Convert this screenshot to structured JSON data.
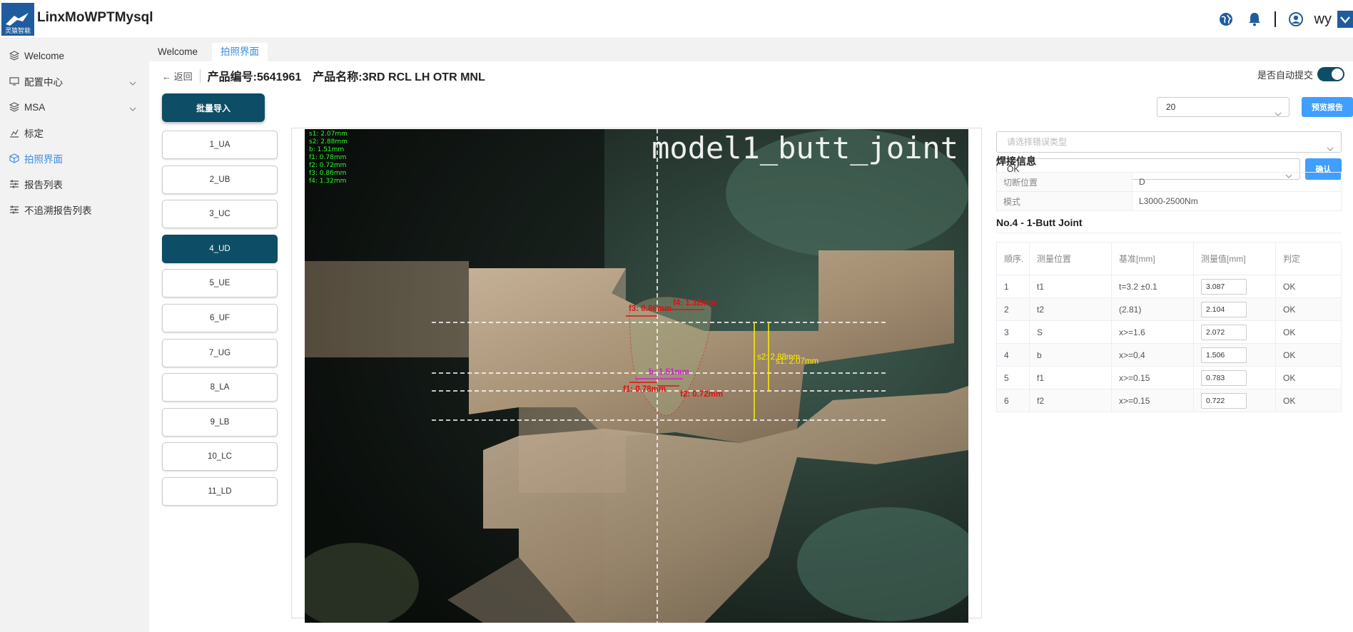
{
  "app": {
    "title": "LinxMoWPTMysql",
    "logo_text": "灵猿智能",
    "username": "wy"
  },
  "sidebar": {
    "items": [
      {
        "label": "Welcome",
        "icon": "layers-icon"
      },
      {
        "label": "配置中心",
        "icon": "monitor-icon",
        "expandable": true
      },
      {
        "label": "MSA",
        "icon": "layers-icon",
        "expandable": true
      },
      {
        "label": "标定",
        "icon": "chart-icon"
      },
      {
        "label": "拍照界面",
        "icon": "cube-icon",
        "active": true
      },
      {
        "label": "报告列表",
        "icon": "sliders-icon"
      },
      {
        "label": "不追溯报告列表",
        "icon": "sliders-icon"
      }
    ]
  },
  "tabs": [
    {
      "label": "Welcome"
    },
    {
      "label": "拍照界面",
      "active": true
    }
  ],
  "header": {
    "back_label": "返回",
    "product_code": "产品编号:5641961",
    "product_name": "产品名称:3RD RCL LH OTR MNL",
    "auto_submit_label": "是否自动提交"
  },
  "left": {
    "import_label": "批量导入",
    "samples": [
      "1_UA",
      "2_UB",
      "3_UC",
      "4_UD",
      "5_UE",
      "6_UF",
      "7_UG",
      "8_LA",
      "9_LB",
      "10_LC",
      "11_LD"
    ],
    "active_sample": "4_UD"
  },
  "image": {
    "title": "model1_butt_joint",
    "measures": [
      "s1: 2.07mm",
      "s2: 2.88mm",
      "b: 1.51mm",
      "f1: 0.78mm",
      "f2: 0.72mm",
      "f3: 0.86mm",
      "f4: 1.32mm"
    ],
    "annotations": {
      "f3": "f3: 0.86mm",
      "f4": "f4: 1.32mm",
      "b": "b: 1.51mm",
      "f1": "f1: 0.78mm",
      "f2": "f2: 0.72mm",
      "s2": "s2: 2.88mm",
      "s1": "s1: 2.07mm"
    }
  },
  "controls": {
    "page_size": "20",
    "preview_label": "预览报告",
    "error_type_placeholder": "请选择错误类型",
    "result_value": "OK",
    "confirm_label": "确认"
  },
  "weld_info": {
    "title": "焊接信息",
    "rows": [
      {
        "key": "切断位置",
        "value": "D"
      },
      {
        "key": "模式",
        "value": "L3000-2500Nm"
      }
    ]
  },
  "measurement": {
    "title": "No.4 - 1-Butt Joint",
    "columns": [
      "顺序.",
      "测量位置",
      "基准[mm]",
      "测量值[mm]",
      "判定"
    ],
    "rows": [
      {
        "no": "1",
        "position": "t1",
        "standard": "t=3.2 ±0.1",
        "value": "3.087",
        "result": "OK"
      },
      {
        "no": "2",
        "position": "t2",
        "standard": "(2.81)",
        "value": "2.104",
        "result": "OK"
      },
      {
        "no": "3",
        "position": "S",
        "standard": "x>=1.6",
        "value": "2.072",
        "result": "OK"
      },
      {
        "no": "4",
        "position": "b",
        "standard": "x>=0.4",
        "value": "1.506",
        "result": "OK"
      },
      {
        "no": "5",
        "position": "f1",
        "standard": "x>=0.15",
        "value": "0.783",
        "result": "OK"
      },
      {
        "no": "6",
        "position": "f2",
        "standard": "x>=0.15",
        "value": "0.722",
        "result": "OK"
      }
    ]
  },
  "colors": {
    "primary_dark": "#0e4d66",
    "primary_blue": "#409eff",
    "active_text": "#3a8ee6",
    "measure_green": "#22ff22",
    "annotation_red": "#e01010",
    "annotation_yellow": "#ffee00",
    "annotation_magenta": "#d020d0"
  }
}
